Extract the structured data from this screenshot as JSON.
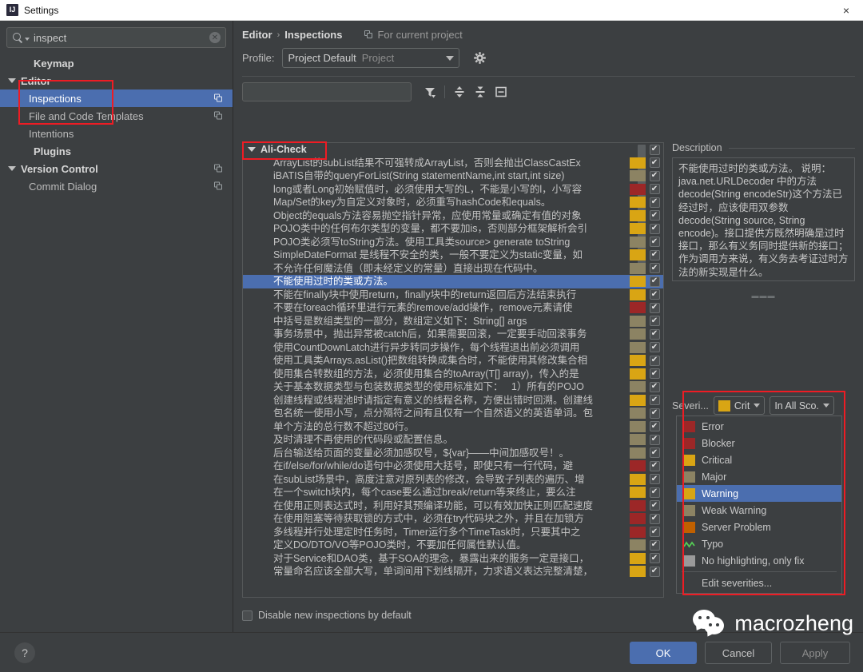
{
  "window": {
    "title": "Settings",
    "app_icon": "intellij-icon",
    "close_label": "×"
  },
  "sidebar": {
    "search": {
      "value": "inspect",
      "placeholder": "",
      "icon": "search-icon",
      "clear_icon": "clear-icon"
    },
    "items": [
      {
        "label": "Keymap",
        "level": 0,
        "bold": true,
        "arrow": false,
        "copy": false,
        "selected": false
      },
      {
        "label": "Editor",
        "level": 0,
        "bold": true,
        "arrow": true,
        "copy": false,
        "selected": false
      },
      {
        "label": "Inspections",
        "level": 1,
        "bold": false,
        "arrow": false,
        "copy": true,
        "selected": true
      },
      {
        "label": "File and Code Templates",
        "level": 1,
        "bold": false,
        "arrow": false,
        "copy": true,
        "selected": false
      },
      {
        "label": "Intentions",
        "level": 1,
        "bold": false,
        "arrow": false,
        "copy": false,
        "selected": false
      },
      {
        "label": "Plugins",
        "level": 0,
        "bold": true,
        "arrow": false,
        "copy": false,
        "selected": false
      },
      {
        "label": "Version Control",
        "level": 0,
        "bold": true,
        "arrow": true,
        "copy": true,
        "selected": false
      },
      {
        "label": "Commit Dialog",
        "level": 1,
        "bold": false,
        "arrow": false,
        "copy": true,
        "selected": false
      }
    ]
  },
  "main": {
    "breadcrumb": {
      "parent": "Editor",
      "separator": "›",
      "current": "Inspections"
    },
    "for_current_project": {
      "label": "For current project",
      "icon": "copy-icon"
    },
    "profile": {
      "label": "Profile:",
      "value": "Project Default",
      "scope": "Project",
      "gear_icon": "gear-icon",
      "caret_icon": "chevron-down-icon"
    },
    "toolbar": {
      "search_placeholder": "",
      "filter_icon": "filter-icon",
      "expand_all_icon": "expand-all-icon",
      "collapse_all_icon": "collapse-all-icon",
      "reset_icon": "reset-icon"
    },
    "disable_new": {
      "label": "Disable new inspections by default",
      "checked": false
    }
  },
  "inspection_list": {
    "group": {
      "label": "Ali-Check",
      "expanded": true,
      "checked": true
    },
    "rows": [
      {
        "text": "ArrayList的subList结果不可强转成ArrayList，否则会抛出ClassCastEx",
        "severity": "Critical",
        "color": "#d9a514",
        "checked": true
      },
      {
        "text": "iBATIS自带的queryForList(String statementName,int start,int size)",
        "severity": "Major",
        "color": "#8c8363",
        "checked": true
      },
      {
        "text": "long或者Long初始赋值时，必须使用大写的L，不能是小写的l，小写容",
        "severity": "Blocker",
        "color": "#9c2727",
        "checked": true
      },
      {
        "text": "Map/Set的key为自定义对象时，必须重写hashCode和equals。",
        "severity": "Critical",
        "color": "#d9a514",
        "checked": true
      },
      {
        "text": "Object的equals方法容易抛空指针异常，应使用常量或确定有值的对象",
        "severity": "Critical",
        "color": "#d9a514",
        "checked": true
      },
      {
        "text": "POJO类中的任何布尔类型的变量，都不要加is，否则部分框架解析会引",
        "severity": "Critical",
        "color": "#d9a514",
        "checked": true
      },
      {
        "text": "POJO类必须写toString方法。使用工具类source> generate toString",
        "severity": "Major",
        "color": "#8c8363",
        "checked": true
      },
      {
        "text": "SimpleDateFormat 是线程不安全的类，一般不要定义为static变量，如",
        "severity": "Critical",
        "color": "#d9a514",
        "checked": true
      },
      {
        "text": "不允许任何魔法值（即未经定义的常量）直接出现在代码中。",
        "severity": "Major",
        "color": "#8c8363",
        "checked": true
      },
      {
        "text": "不能使用过时的类或方法。",
        "severity": "Critical",
        "color": "#d9a514",
        "checked": true,
        "selected": true
      },
      {
        "text": "不能在finally块中使用return，finally块中的return返回后方法结束执行",
        "severity": "Critical",
        "color": "#d9a514",
        "checked": true
      },
      {
        "text": "不要在foreach循环里进行元素的remove/add操作，remove元素请使",
        "severity": "Blocker",
        "color": "#9c2727",
        "checked": true
      },
      {
        "text": "中括号是数组类型的一部分，数组定义如下：String[] args",
        "severity": "Major",
        "color": "#8c8363",
        "checked": true
      },
      {
        "text": "事务场景中，抛出异常被catch后，如果需要回滚，一定要手动回滚事务",
        "severity": "Major",
        "color": "#8c8363",
        "checked": true
      },
      {
        "text": "使用CountDownLatch进行异步转同步操作，每个线程退出前必须调用",
        "severity": "Major",
        "color": "#8c8363",
        "checked": true
      },
      {
        "text": "使用工具类Arrays.asList()把数组转换成集合时，不能使用其修改集合相",
        "severity": "Critical",
        "color": "#d9a514",
        "checked": true
      },
      {
        "text": "使用集合转数组的方法，必须使用集合的toArray(T[] array)，传入的是",
        "severity": "Critical",
        "color": "#d9a514",
        "checked": true
      },
      {
        "text": "关于基本数据类型与包装数据类型的使用标准如下：   1）所有的POJO",
        "severity": "Major",
        "color": "#8c8363",
        "checked": true
      },
      {
        "text": "创建线程或线程池时请指定有意义的线程名称，方便出错时回溯。创建线",
        "severity": "Critical",
        "color": "#d9a514",
        "checked": true
      },
      {
        "text": "包名统一使用小写，点分隔符之间有且仅有一个自然语义的英语单词。包",
        "severity": "Major",
        "color": "#8c8363",
        "checked": true
      },
      {
        "text": "单个方法的总行数不超过80行。",
        "severity": "Major",
        "color": "#8c8363",
        "checked": true
      },
      {
        "text": "及时清理不再使用的代码段或配置信息。",
        "severity": "Major",
        "color": "#8c8363",
        "checked": true
      },
      {
        "text": "后台输送给页面的变量必须加感叹号，${var}——中间加感叹号！。",
        "severity": "Major",
        "color": "#8c8363",
        "checked": true
      },
      {
        "text": "在if/else/for/while/do语句中必须使用大括号，即使只有一行代码，避",
        "severity": "Blocker",
        "color": "#9c2727",
        "checked": true
      },
      {
        "text": "在subList场景中，高度注意对原列表的修改，会导致子列表的遍历、增",
        "severity": "Critical",
        "color": "#d9a514",
        "checked": true
      },
      {
        "text": "在一个switch块内，每个case要么通过break/return等来终止，要么注",
        "severity": "Critical",
        "color": "#d9a514",
        "checked": true
      },
      {
        "text": "在使用正则表达式时，利用好其预编译功能，可以有效加快正则匹配速度",
        "severity": "Blocker",
        "color": "#9c2727",
        "checked": true
      },
      {
        "text": "在使用阻塞等待获取锁的方式中，必须在try代码块之外，并且在加锁方",
        "severity": "Blocker",
        "color": "#9c2727",
        "checked": true
      },
      {
        "text": "多线程并行处理定时任务时，Timer运行多个TimeTask时，只要其中之",
        "severity": "Blocker",
        "color": "#9c2727",
        "checked": true
      },
      {
        "text": "定义DO/DTO/VO等POJO类时，不要加任何属性默认值。",
        "severity": "Major",
        "color": "#8c8363",
        "checked": true
      },
      {
        "text": "对于Service和DAO类，基于SOA的理念，暴露出来的服务一定是接口，",
        "severity": "Critical",
        "color": "#d9a514",
        "checked": true
      },
      {
        "text": "常量命名应该全部大写，单词间用下划线隔开，力求语义表达完整清楚，",
        "severity": "Critical",
        "color": "#d9a514",
        "checked": true
      }
    ]
  },
  "description": {
    "header": "Description",
    "body": "不能使用过时的类或方法。\n说明：java.net.URLDecoder 中的方法decode(String encodeStr)这个方法已经过时，应该使用双参数decode(String source, String encode)。接口提供方既然明确是过时接口，那么有义务同时提供新的接口；作为调用方来说，有义务去考证过时方法的新实现是什么。"
  },
  "severity": {
    "label": "Severi...",
    "selected_value": "Crit",
    "selected_color": "#d9a514",
    "scope_value": "In All Sco.",
    "dropdown": {
      "open": true,
      "items": [
        {
          "label": "Error",
          "color": "#9c2727",
          "type": "swatch",
          "active": false
        },
        {
          "label": "Blocker",
          "color": "#9c2727",
          "type": "swatch",
          "active": false
        },
        {
          "label": "Critical",
          "color": "#d9a514",
          "type": "swatch",
          "active": false
        },
        {
          "label": "Major",
          "color": "#8c8363",
          "type": "swatch",
          "active": false
        },
        {
          "label": "Warning",
          "color": "#d9a514",
          "type": "swatch",
          "active": true
        },
        {
          "label": "Weak Warning",
          "color": "#8c8363",
          "type": "swatch",
          "active": false
        },
        {
          "label": "Server Problem",
          "color": "#c06000",
          "type": "swatch",
          "active": false
        },
        {
          "label": "Typo",
          "color": "#55cc55",
          "type": "squiggle",
          "active": false
        },
        {
          "label": "No highlighting, only fix",
          "color": "#9a9a9a",
          "type": "swatch",
          "active": false
        }
      ],
      "edit_label": "Edit severities..."
    }
  },
  "buttons": {
    "help": "?",
    "ok": "OK",
    "cancel": "Cancel",
    "apply": "Apply"
  },
  "watermark": {
    "text": "macrozheng",
    "icon": "wechat-icon"
  },
  "colors": {
    "accent": "#4b6eaf",
    "annotation": "#ee1c24",
    "background": "#3c3f41",
    "critical": "#d9a514",
    "blocker": "#9c2727",
    "major": "#8c8363"
  }
}
